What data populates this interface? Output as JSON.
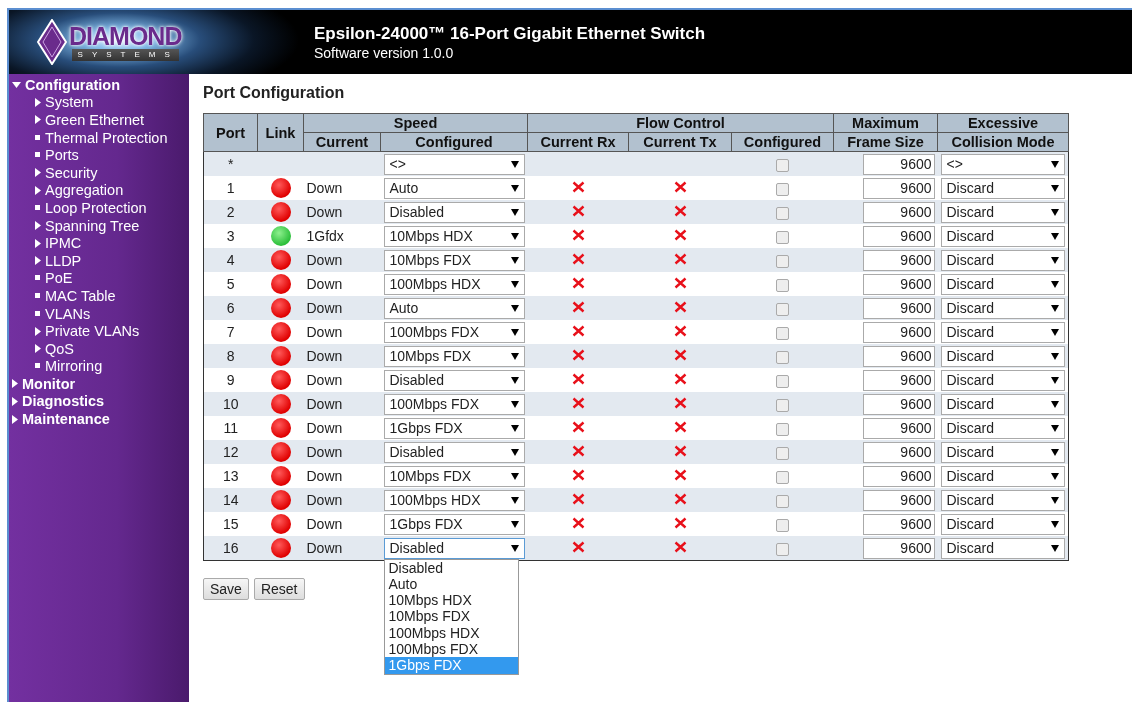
{
  "header": {
    "brand": "DIAMOND",
    "tagline": "SYSTEMS",
    "title": "Epsilon-24000™ 16-Port Gigabit Ethernet Switch",
    "subtitle": "Software version 1.0.0"
  },
  "sidebar": {
    "items": [
      {
        "label": "Configuration",
        "kind": "folder",
        "expanded": true,
        "children": [
          {
            "label": "System",
            "kind": "folder",
            "expanded": false
          },
          {
            "label": "Green Ethernet",
            "kind": "folder",
            "expanded": false
          },
          {
            "label": "Thermal Protection",
            "kind": "page"
          },
          {
            "label": "Ports",
            "kind": "page"
          },
          {
            "label": "Security",
            "kind": "folder",
            "expanded": false
          },
          {
            "label": "Aggregation",
            "kind": "folder",
            "expanded": false
          },
          {
            "label": "Loop Protection",
            "kind": "page"
          },
          {
            "label": "Spanning Tree",
            "kind": "folder",
            "expanded": false
          },
          {
            "label": "IPMC",
            "kind": "folder",
            "expanded": false
          },
          {
            "label": "LLDP",
            "kind": "folder",
            "expanded": false
          },
          {
            "label": "PoE",
            "kind": "page"
          },
          {
            "label": "MAC Table",
            "kind": "page"
          },
          {
            "label": "VLANs",
            "kind": "page"
          },
          {
            "label": "Private VLANs",
            "kind": "folder",
            "expanded": false
          },
          {
            "label": "QoS",
            "kind": "folder",
            "expanded": false
          },
          {
            "label": "Mirroring",
            "kind": "page"
          }
        ]
      },
      {
        "label": "Monitor",
        "kind": "folder",
        "expanded": false
      },
      {
        "label": "Diagnostics",
        "kind": "folder",
        "expanded": false
      },
      {
        "label": "Maintenance",
        "kind": "folder",
        "expanded": false
      }
    ]
  },
  "page_title": "Port Configuration",
  "table": {
    "headers": {
      "port": "Port",
      "link": "Link",
      "speed": "Speed",
      "speed_current": "Current",
      "speed_configured": "Configured",
      "flow": "Flow Control",
      "flow_rx": "Current Rx",
      "flow_tx": "Current Tx",
      "flow_configured": "Configured",
      "frame_1": "Maximum",
      "frame_2": "Frame Size",
      "collision_1": "Excessive",
      "collision_2": "Collision Mode"
    },
    "rows": [
      {
        "kind": "all",
        "port": "*",
        "speed": "<>",
        "flow_checked": false,
        "frame_size": "9600",
        "collision": "<>"
      },
      {
        "kind": "port",
        "port": "1",
        "link_up": false,
        "current": "Down",
        "speed": "Auto",
        "rx": false,
        "tx": false,
        "flow_checked": false,
        "frame_size": "9600",
        "collision": "Discard"
      },
      {
        "kind": "port",
        "port": "2",
        "link_up": false,
        "current": "Down",
        "speed": "Disabled",
        "rx": false,
        "tx": false,
        "flow_checked": false,
        "frame_size": "9600",
        "collision": "Discard"
      },
      {
        "kind": "port",
        "port": "3",
        "link_up": true,
        "current": "1Gfdx",
        "speed": "10Mbps HDX",
        "rx": false,
        "tx": false,
        "flow_checked": false,
        "frame_size": "9600",
        "collision": "Discard"
      },
      {
        "kind": "port",
        "port": "4",
        "link_up": false,
        "current": "Down",
        "speed": "10Mbps FDX",
        "rx": false,
        "tx": false,
        "flow_checked": false,
        "frame_size": "9600",
        "collision": "Discard"
      },
      {
        "kind": "port",
        "port": "5",
        "link_up": false,
        "current": "Down",
        "speed": "100Mbps HDX",
        "rx": false,
        "tx": false,
        "flow_checked": false,
        "frame_size": "9600",
        "collision": "Discard"
      },
      {
        "kind": "port",
        "port": "6",
        "link_up": false,
        "current": "Down",
        "speed": "Auto",
        "rx": false,
        "tx": false,
        "flow_checked": false,
        "frame_size": "9600",
        "collision": "Discard"
      },
      {
        "kind": "port",
        "port": "7",
        "link_up": false,
        "current": "Down",
        "speed": "100Mbps FDX",
        "rx": false,
        "tx": false,
        "flow_checked": false,
        "frame_size": "9600",
        "collision": "Discard"
      },
      {
        "kind": "port",
        "port": "8",
        "link_up": false,
        "current": "Down",
        "speed": "10Mbps FDX",
        "rx": false,
        "tx": false,
        "flow_checked": false,
        "frame_size": "9600",
        "collision": "Discard"
      },
      {
        "kind": "port",
        "port": "9",
        "link_up": false,
        "current": "Down",
        "speed": "Disabled",
        "rx": false,
        "tx": false,
        "flow_checked": false,
        "frame_size": "9600",
        "collision": "Discard"
      },
      {
        "kind": "port",
        "port": "10",
        "link_up": false,
        "current": "Down",
        "speed": "100Mbps FDX",
        "rx": false,
        "tx": false,
        "flow_checked": false,
        "frame_size": "9600",
        "collision": "Discard"
      },
      {
        "kind": "port",
        "port": "11",
        "link_up": false,
        "current": "Down",
        "speed": "1Gbps FDX",
        "rx": false,
        "tx": false,
        "flow_checked": false,
        "frame_size": "9600",
        "collision": "Discard"
      },
      {
        "kind": "port",
        "port": "12",
        "link_up": false,
        "current": "Down",
        "speed": "Disabled",
        "rx": false,
        "tx": false,
        "flow_checked": false,
        "frame_size": "9600",
        "collision": "Discard"
      },
      {
        "kind": "port",
        "port": "13",
        "link_up": false,
        "current": "Down",
        "speed": "10Mbps FDX",
        "rx": false,
        "tx": false,
        "flow_checked": false,
        "frame_size": "9600",
        "collision": "Discard"
      },
      {
        "kind": "port",
        "port": "14",
        "link_up": false,
        "current": "Down",
        "speed": "100Mbps HDX",
        "rx": false,
        "tx": false,
        "flow_checked": false,
        "frame_size": "9600",
        "collision": "Discard"
      },
      {
        "kind": "port",
        "port": "15",
        "link_up": false,
        "current": "Down",
        "speed": "1Gbps FDX",
        "rx": false,
        "tx": false,
        "flow_checked": false,
        "frame_size": "9600",
        "collision": "Discard"
      },
      {
        "kind": "port",
        "port": "16",
        "link_up": false,
        "current": "Down",
        "speed": "Disabled",
        "rx": false,
        "tx": false,
        "flow_checked": false,
        "frame_size": "9600",
        "collision": "Discard",
        "focused": true
      }
    ]
  },
  "speed_dropdown": {
    "options": [
      {
        "label": "Disabled",
        "selected": false
      },
      {
        "label": "Auto",
        "selected": false
      },
      {
        "label": "10Mbps HDX",
        "selected": false
      },
      {
        "label": "10Mbps FDX",
        "selected": false
      },
      {
        "label": "100Mbps HDX",
        "selected": false
      },
      {
        "label": "100Mbps FDX",
        "selected": false
      },
      {
        "label": "1Gbps FDX",
        "selected": true
      }
    ]
  },
  "buttons": [
    "Save",
    "Reset"
  ]
}
